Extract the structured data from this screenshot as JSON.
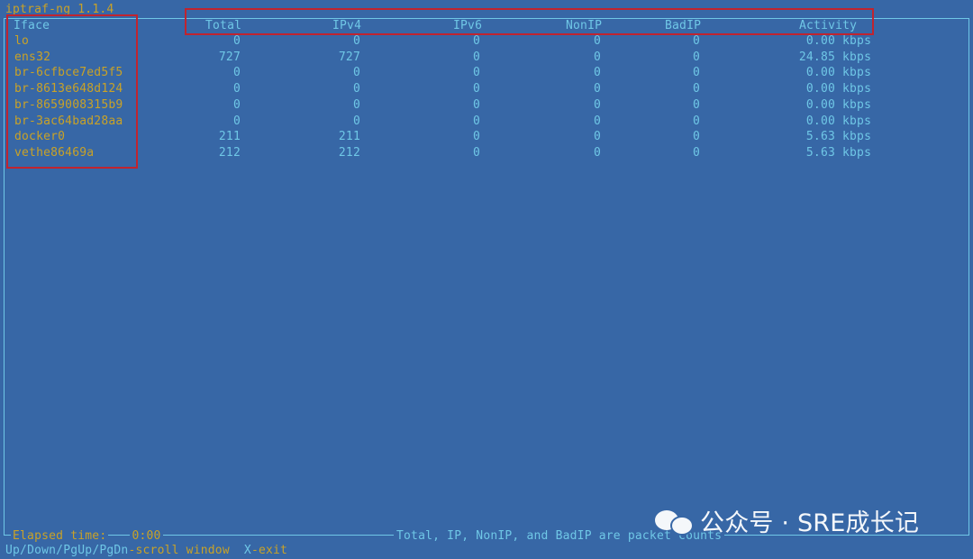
{
  "app": {
    "title": "iptraf-ng 1.1.4"
  },
  "columns": {
    "iface": "Iface",
    "total": "Total",
    "ipv4": "IPv4",
    "ipv6": "IPv6",
    "nonip": "NonIP",
    "badip": "BadIP",
    "activity": "Activity"
  },
  "rows": [
    {
      "iface": "lo",
      "total": "0",
      "ipv4": "0",
      "ipv6": "0",
      "nonip": "0",
      "badip": "0",
      "activity": "0.00",
      "unit": "kbps"
    },
    {
      "iface": "ens32",
      "total": "727",
      "ipv4": "727",
      "ipv6": "0",
      "nonip": "0",
      "badip": "0",
      "activity": "24.85",
      "unit": "kbps"
    },
    {
      "iface": "br-6cfbce7ed5f5",
      "total": "0",
      "ipv4": "0",
      "ipv6": "0",
      "nonip": "0",
      "badip": "0",
      "activity": "0.00",
      "unit": "kbps"
    },
    {
      "iface": "br-8613e648d124",
      "total": "0",
      "ipv4": "0",
      "ipv6": "0",
      "nonip": "0",
      "badip": "0",
      "activity": "0.00",
      "unit": "kbps"
    },
    {
      "iface": "br-8659008315b9",
      "total": "0",
      "ipv4": "0",
      "ipv6": "0",
      "nonip": "0",
      "badip": "0",
      "activity": "0.00",
      "unit": "kbps"
    },
    {
      "iface": "br-3ac64bad28aa",
      "total": "0",
      "ipv4": "0",
      "ipv6": "0",
      "nonip": "0",
      "badip": "0",
      "activity": "0.00",
      "unit": "kbps"
    },
    {
      "iface": "docker0",
      "total": "211",
      "ipv4": "211",
      "ipv6": "0",
      "nonip": "0",
      "badip": "0",
      "activity": "5.63",
      "unit": "kbps"
    },
    {
      "iface": "vethe86469a",
      "total": "212",
      "ipv4": "212",
      "ipv6": "0",
      "nonip": "0",
      "badip": "0",
      "activity": "5.63",
      "unit": "kbps"
    }
  ],
  "footer": {
    "elapsed_label": "Elapsed time:",
    "elapsed_value": "0:00",
    "note": "Total, IP, NonIP, and BadIP are packet counts"
  },
  "keys": {
    "scroll_key": "Up/Down/PgUp/PgDn",
    "scroll_desc": "-scroll window",
    "exit_key": "X",
    "exit_desc": "-exit"
  },
  "watermark": {
    "text": "公众号 · SRE成长记",
    "icon": "wechat-icon"
  },
  "colors": {
    "background": "#3767a6",
    "cyan": "#6fc7e6",
    "yellow": "#c9a227",
    "highlight_box": "#c0242f"
  }
}
